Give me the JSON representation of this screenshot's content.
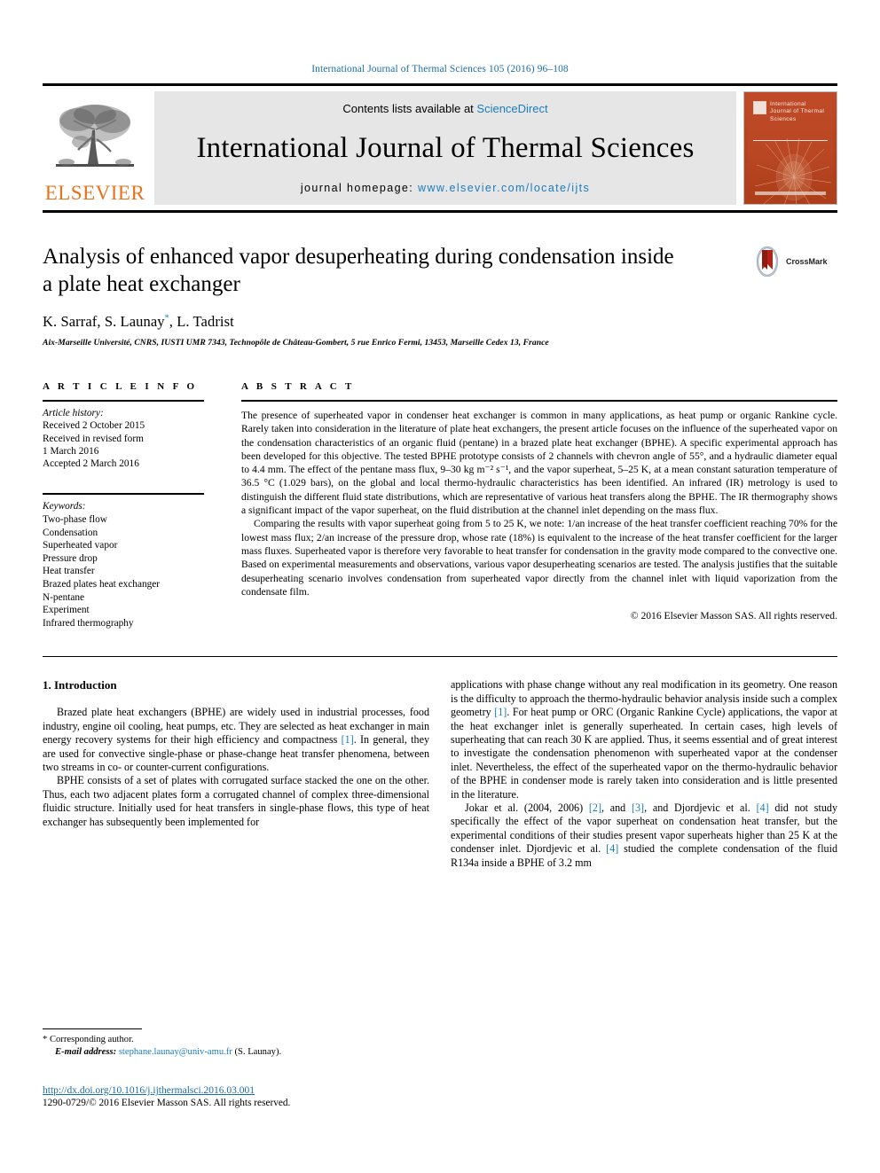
{
  "running_head": "International Journal of Thermal Sciences 105 (2016) 96–108",
  "masthead": {
    "publisher_logo_text": "ELSEVIER",
    "contents_prefix": "Contents lists available at ",
    "contents_link": "ScienceDirect",
    "journal_title": "International Journal of Thermal Sciences",
    "homepage_prefix": "journal homepage: ",
    "homepage_url": "www.elsevier.com/locate/ijts",
    "cover_title": "International Journal of Thermal Sciences"
  },
  "article": {
    "title": "Analysis of enhanced vapor desuperheating during condensation inside a plate heat exchanger",
    "authors": "K. Sarraf, S. Launay",
    "authors_tail": ", L. Tadrist",
    "corresponding_marker": "*",
    "affiliation": "Aix-Marseille Université, CNRS, IUSTI UMR 7343, Technopôle de Château-Gombert, 5 rue Enrico Fermi, 13453, Marseille Cedex 13, France",
    "crossmark_label": "CrossMark"
  },
  "article_info": {
    "heading": "A R T I C L E  I N F O",
    "history_label": "Article history:",
    "history": [
      "Received 2 October 2015",
      "Received in revised form",
      "1 March 2016",
      "Accepted 2 March 2016"
    ],
    "keywords_label": "Keywords:",
    "keywords": [
      "Two-phase flow",
      "Condensation",
      "Superheated vapor",
      "Pressure drop",
      "Heat transfer",
      "Brazed plates heat exchanger",
      "N-pentane",
      "Experiment",
      "Infrared thermography"
    ]
  },
  "abstract": {
    "heading": "A B S T R A C T",
    "paragraph_1": "The presence of superheated vapor in condenser heat exchanger is common in many applications, as heat pump or organic Rankine cycle. Rarely taken into consideration in the literature of plate heat exchangers, the present article focuses on the influence of the superheated vapor on the condensation characteristics of an organic fluid (pentane) in a brazed plate heat exchanger (BPHE). A specific experimental approach has been developed for this objective. The tested BPHE prototype consists of 2 channels with chevron angle of 55°, and a hydraulic diameter equal to 4.4 mm. The effect of the pentane mass flux, 9–30 kg m⁻² s⁻¹, and the vapor superheat, 5–25 K, at a mean constant saturation temperature of 36.5 °C (1.029 bars), on the global and local thermo-hydraulic characteristics has been identified. An infrared (IR) metrology is used to distinguish the different fluid state distributions, which are representative of various heat transfers along the BPHE. The IR thermography shows a significant impact of the vapor superheat, on the fluid distribution at the channel inlet depending on the mass flux.",
    "paragraph_2": "Comparing the results with vapor superheat going from 5 to 25 K, we note: 1/an increase of the heat transfer coefficient reaching 70% for the lowest mass flux; 2/an increase of the pressure drop, whose rate (18%) is equivalent to the increase of the heat transfer coefficient for the larger mass fluxes. Superheated vapor is therefore very favorable to heat transfer for condensation in the gravity mode compared to the convective one. Based on experimental measurements and observations, various vapor desuperheating scenarios are tested. The analysis justifies that the suitable desuperheating scenario involves condensation from superheated vapor directly from the channel inlet with liquid vaporization from the condensate film.",
    "copyright": "© 2016 Elsevier Masson SAS. All rights reserved."
  },
  "introduction": {
    "heading": "1. Introduction",
    "left_p1": "Brazed plate heat exchangers (BPHE) are widely used in industrial processes, food industry, engine oil cooling, heat pumps, etc. They are selected as heat exchanger in main energy recovery systems for their high efficiency and compactness [1]. In general, they are used for convective single-phase or phase-change heat transfer phenomena, between two streams in co- or counter-current configurations.",
    "left_p2": "BPHE consists of a set of plates with corrugated surface stacked the one on the other. Thus, each two adjacent plates form a corrugated channel of complex three-dimensional fluidic structure. Initially used for heat transfers in single-phase flows, this type of heat exchanger has subsequently been implemented for",
    "right_p1": "applications with phase change without any real modification in its geometry. One reason is the difficulty to approach the thermo-hydraulic behavior analysis inside such a complex geometry [1]. For heat pump or ORC (Organic Rankine Cycle) applications, the vapor at the heat exchanger inlet is generally superheated. In certain cases, high levels of superheating that can reach 30 K are applied. Thus, it seems essential and of great interest to investigate the condensation phenomenon with superheated vapor at the condenser inlet. Nevertheless, the effect of the superheated vapor on the thermo-hydraulic behavior of the BPHE in condenser mode is rarely taken into consideration and is little presented in the literature.",
    "right_p2": "Jokar et al. (2004, 2006) [2], and [3], and Djordjevic et al. [4] did not study specifically the effect of the vapor superheat on condensation heat transfer, but the experimental conditions of their studies present vapor superheats higher than 25 K at the condenser inlet. Djordjevic et al. [4] studied the complete condensation of the fluid R134a inside a BPHE of 3.2 mm"
  },
  "footnote": {
    "corresponding": "* Corresponding author.",
    "email_label": "E-mail address:",
    "email": "stephane.launay@univ-amu.fr",
    "email_owner": "(S. Launay)."
  },
  "doi": {
    "url": "http://dx.doi.org/10.1016/j.ijthermalsci.2016.03.001",
    "issn_line": "1290-0729/© 2016 Elsevier Masson SAS. All rights reserved."
  },
  "colors": {
    "link_blue": "#1a7cbf",
    "elsevier_orange": "#E9711C",
    "cover_orange": "#b9462"
  }
}
